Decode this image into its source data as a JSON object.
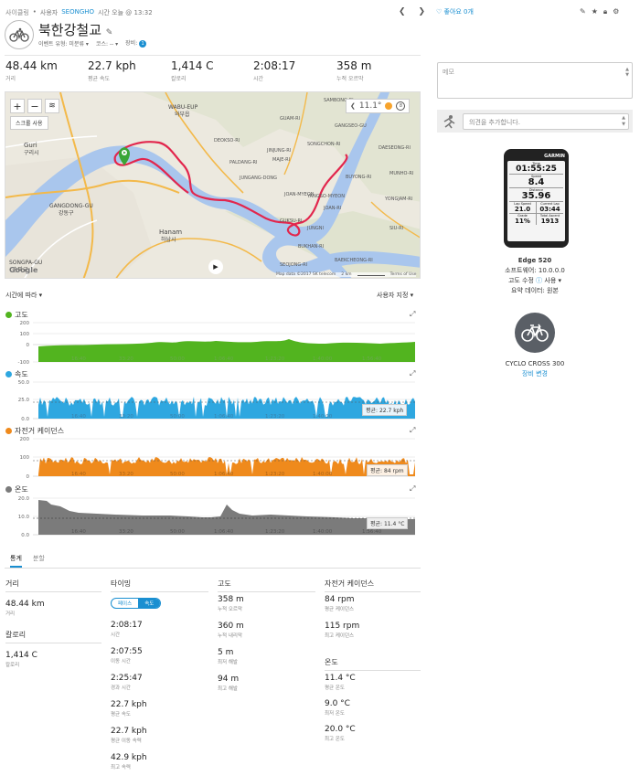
{
  "header": {
    "breadcrumb_activity": "사이클링",
    "user_prefix": "사용자",
    "user_name": "SEONGHO",
    "time_text": "시간 오늘 @ 13:32",
    "title": "북한강철교",
    "event_type": "이벤트 유형: 미분류",
    "course": "코스: --",
    "equipment": "장비:",
    "equipment_count": "1",
    "likes": "좋아요 0개"
  },
  "stats": [
    {
      "value": "48.44 km",
      "label": "거리"
    },
    {
      "value": "22.7 kph",
      "label": "평균 속도"
    },
    {
      "value": "1,414 C",
      "label": "칼로리"
    },
    {
      "value": "2:08:17",
      "label": "시간"
    },
    {
      "value": "358 m",
      "label": "누적 오르막"
    }
  ],
  "map": {
    "scale_button": "스크롤 사용",
    "weather_temp": "11.1°",
    "wind": "8",
    "attribution": "Map data ©2017 SK telecom",
    "scale": "2 km",
    "terms": "Terms of Use",
    "google": "Google",
    "places": [
      "Guri",
      "구리시",
      "WABU-EUP",
      "와부읍",
      "GANGDONG-GU",
      "강동구",
      "Hanam",
      "하남시",
      "SONGPA-GU",
      "송파구",
      "PALDANG-RI",
      "YANGSO-MYEON",
      "JOAN-MYEON",
      "DEOKSO-RI",
      "JUNGANG-DONG",
      "SONGCHON-RI",
      "GANGSEO-GU",
      "MAJE-RI",
      "JINJUNG-RI",
      "GUKSU-RI",
      "JUNGNI",
      "BUKHAN-RI",
      "BUYONG-RI",
      "DAESEONG-RI",
      "YONGJAM-RI",
      "SAMBONG-RI",
      "GUAM-RI",
      "MUNHO-RI",
      "SIU-RI",
      "JOAN-RI",
      "BAEKCHEONG-RI",
      "SEOJONG-RI"
    ]
  },
  "charts": {
    "sort_label": "시간에 따라",
    "user_setting": "사용자 지정",
    "x_ticks": [
      "16:40",
      "33:20",
      "50:00",
      "1:06:40",
      "1:23:20",
      "1:40:00",
      "1:56:40"
    ],
    "elevation": {
      "title": "고도",
      "color": "#52b41f",
      "yticks": [
        "200",
        "100",
        "0",
        "-100"
      ]
    },
    "speed": {
      "title": "속도",
      "color": "#2ea7e0",
      "yticks": [
        "50.0",
        "25.0",
        "0.0"
      ],
      "avg_label": "평균: 22.7 kph"
    },
    "cadence": {
      "title": "자전거 케이던스",
      "color": "#ef8a1c",
      "yticks": [
        "200",
        "100",
        "0"
      ],
      "avg_label": "평균: 84 rpm"
    },
    "temp": {
      "title": "온도",
      "color": "#7b7b7b",
      "yticks": [
        "20.0",
        "10.0",
        "0.0"
      ],
      "avg_label": "평균: 11.4 °C"
    }
  },
  "tabs": [
    "통계",
    "분할"
  ],
  "summary": {
    "distance": {
      "header": "거리",
      "items": [
        {
          "v": "48.44 km",
          "l": "거리"
        }
      ]
    },
    "calories": {
      "header": "칼로리",
      "items": [
        {
          "v": "1,414 C",
          "l": "칼로리"
        }
      ]
    },
    "timing": {
      "header": "타이밍",
      "toggle": [
        "페이스",
        "속도"
      ],
      "items": [
        {
          "v": "2:08:17",
          "l": "시간"
        },
        {
          "v": "2:07:55",
          "l": "이동 시간"
        },
        {
          "v": "2:25:47",
          "l": "경과 시간"
        },
        {
          "v": "22.7 kph",
          "l": "평균 속도"
        },
        {
          "v": "22.7 kph",
          "l": "평균 이동 속력"
        },
        {
          "v": "42.9 kph",
          "l": "최고 속력"
        }
      ]
    },
    "elevation": {
      "header": "고도",
      "items": [
        {
          "v": "358 m",
          "l": "누적 오르막"
        },
        {
          "v": "360 m",
          "l": "누적 내리막"
        },
        {
          "v": "5 m",
          "l": "최저 해발"
        },
        {
          "v": "94 m",
          "l": "최고 해발"
        }
      ]
    },
    "cadence": {
      "header": "자전거 케이던스",
      "items": [
        {
          "v": "84 rpm",
          "l": "평균 케이던스"
        },
        {
          "v": "115 rpm",
          "l": "최고 케이던스"
        }
      ]
    },
    "temperature": {
      "header": "온도",
      "items": [
        {
          "v": "11.4 °C",
          "l": "평균 온도"
        },
        {
          "v": "9.0 °C",
          "l": "최저 온도"
        },
        {
          "v": "20.0 °C",
          "l": "최고 온도"
        }
      ]
    }
  },
  "sidebar": {
    "memo_placeholder": "메모",
    "comment_placeholder": "의견을 추가합니다.",
    "device_name": "Edge 520",
    "firmware": "소프트웨어: 10.0.0.0",
    "elev_correction_label": "고도 수정",
    "elev_correction_value": "사용",
    "summary_data": "요약 데이터: 원본",
    "bike_name": "CYCLO CROSS 300",
    "change_gear": "장비 변경",
    "device_screen": {
      "brand": "GARMIN",
      "time_label": "Time",
      "time": "01:55:25",
      "speed_label": "Speed",
      "speed": "8.4",
      "distance_label": "Distance",
      "distance": "35.96",
      "lap_speed_label": "Lap Speed",
      "lap_speed": "21.0",
      "cur_lap_label": "Current Lap",
      "cur_lap": "03:44",
      "grade_label": "Grade",
      "grade": "11%",
      "ascent_label": "Total Ascent",
      "ascent": "1913"
    }
  }
}
